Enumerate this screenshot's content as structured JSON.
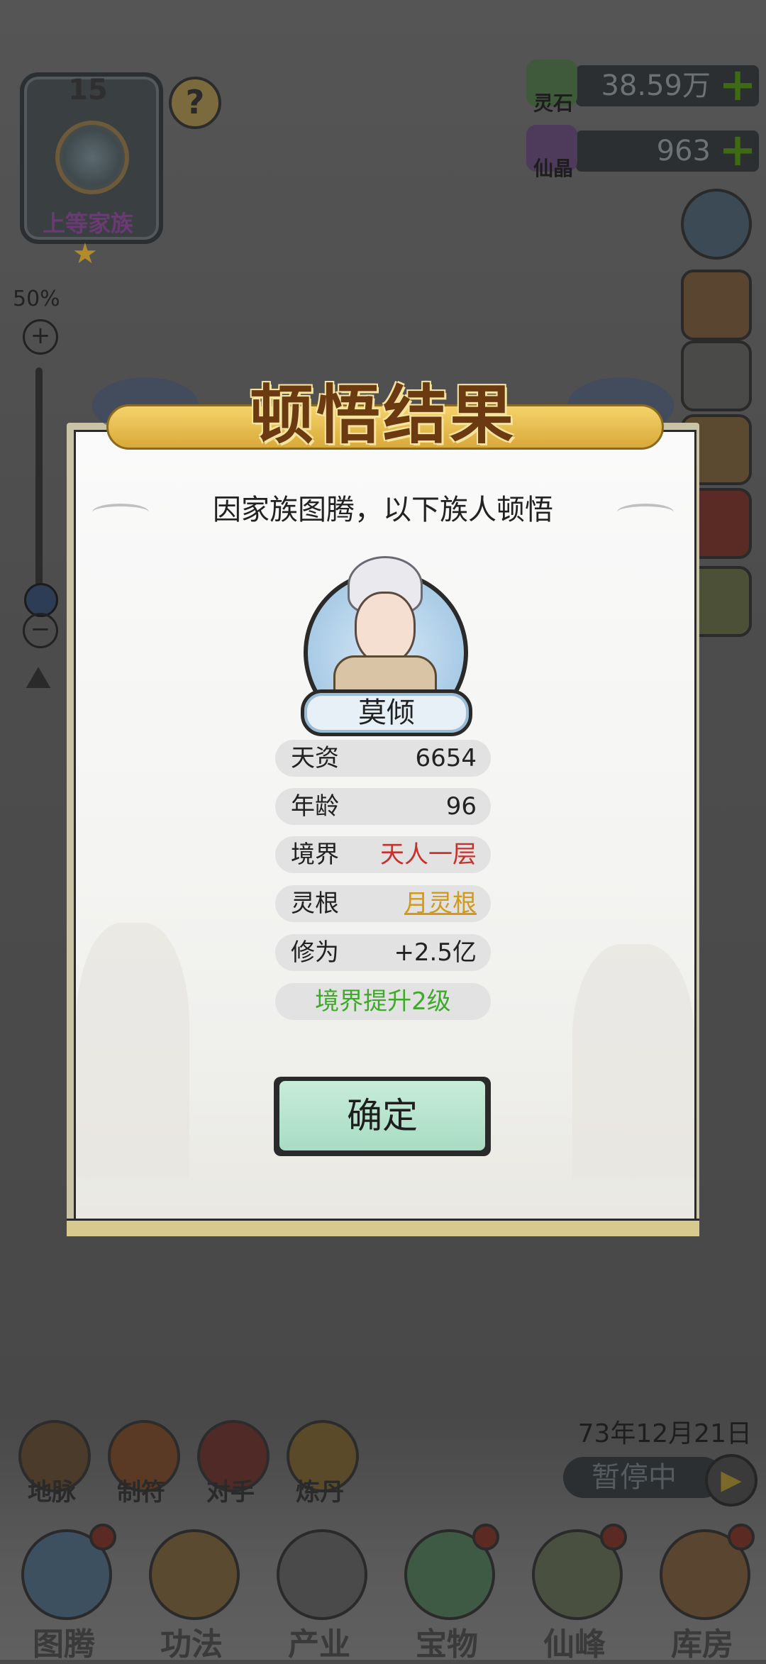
{
  "family": {
    "level": "15",
    "rank": "上等家族"
  },
  "zoom": {
    "percent": "50%",
    "plus": "+",
    "minus": "−"
  },
  "currencies": [
    {
      "label": "灵石",
      "value": "38.59万"
    },
    {
      "label": "仙晶",
      "value": "963"
    }
  ],
  "help": "?",
  "dialog": {
    "title": "顿悟结果",
    "subtitle": "因家族图腾，以下族人顿悟",
    "member_name": "莫倾",
    "stats": [
      {
        "label": "天资",
        "value": "6654"
      },
      {
        "label": "年龄",
        "value": "96"
      },
      {
        "label": "境界",
        "value": "天人一层"
      },
      {
        "label": "灵根",
        "value": "月灵根"
      },
      {
        "label": "修为",
        "value": "+2.5亿"
      }
    ],
    "result": "境界提升2级",
    "confirm": "确定"
  },
  "date": "73年12月21日",
  "pause_label": "暂停中",
  "shortcuts": [
    "地脉",
    "制符",
    "对手",
    "炼丹"
  ],
  "nav": [
    "图腾",
    "功法",
    "产业",
    "宝物",
    "仙峰",
    "库房"
  ],
  "colors": {
    "realm_red": "#c8322d",
    "root_gold": "#d09a1c",
    "result_green": "#3faa2a",
    "confirm_bg": "#bfe7d3"
  }
}
